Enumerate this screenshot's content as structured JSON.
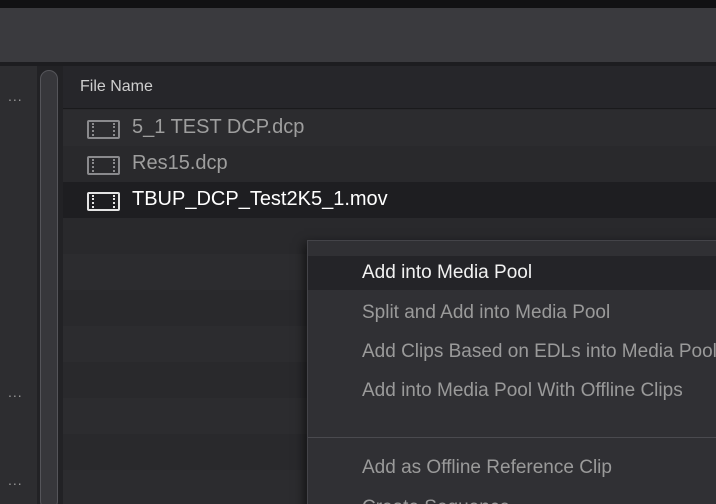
{
  "sidebar": {
    "more_labels": [
      "...",
      "...",
      "..."
    ]
  },
  "list": {
    "header": "File Name",
    "files": [
      {
        "name": "5_1 TEST DCP.dcp"
      },
      {
        "name": "Res15.dcp"
      },
      {
        "name": "TBUP_DCP_Test2K5_1.mov"
      }
    ]
  },
  "context_menu": {
    "items": [
      {
        "label": "Add into Media Pool"
      },
      {
        "label": "Split and Add into Media Pool"
      },
      {
        "label": "Add Clips Based on EDLs into Media Pool"
      },
      {
        "label": "Add into Media Pool With Offline Clips"
      },
      {
        "label": "Add as Offline Reference Clip"
      },
      {
        "label": "Create Sequence"
      }
    ]
  }
}
